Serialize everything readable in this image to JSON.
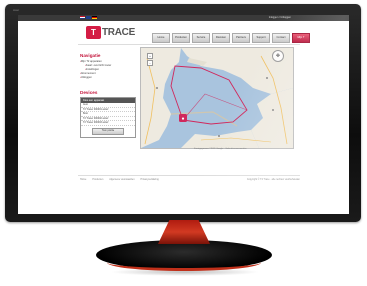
{
  "monitor": {
    "bezel_brand": "Acer"
  },
  "site": {
    "login_text": "Inloggen / Uitloggen",
    "logo_mark": "T",
    "logo_text": "TRACE",
    "flags": [
      "#c8102e",
      "#1f3c88",
      "#000000"
    ],
    "nav": [
      {
        "label": "Home"
      },
      {
        "label": "Producten"
      },
      {
        "label": "Service"
      },
      {
        "label": "Diensten"
      },
      {
        "label": "Partners"
      },
      {
        "label": "Support"
      },
      {
        "label": "Contact"
      },
      {
        "label": "Mijn T"
      }
    ],
    "active_nav_index": 7
  },
  "sidebar": {
    "title": "Navigatie",
    "items": [
      {
        "label": "Mijn T2 apparaten",
        "sub": false
      },
      {
        "label": "Kaart: overzicht tracer",
        "sub": true
      },
      {
        "label": "Instellingen",
        "sub": true
      },
      {
        "label": "Abonnement",
        "sub": false
      },
      {
        "label": "Uitloggen",
        "sub": false
      }
    ],
    "devices_title": "Devices",
    "devices_header": "Kies een apparaat",
    "devices": [
      "Auto",
      "T2 Tracer 000001 actief",
      "Boot",
      "T2 Tracer 000002 actief",
      "T2 Tracer 000003 actief"
    ],
    "devices_button": "Toon positie"
  },
  "map": {
    "copyright": "Kaartgegevens ©2011 Google - Gebruiksvoorwaarden",
    "zoom_in": "+",
    "zoom_out": "−",
    "compass": "✥",
    "route_color": "#d0285c",
    "water_color": "#a9c4de",
    "land_color": "#eeeae0"
  },
  "footer": {
    "links": [
      "Home",
      "Producten",
      "Algemene voorwaarden",
      "Privacyverklaring"
    ],
    "copyright": "Copyright © T2 Trace · alle rechten voorbehouden"
  }
}
